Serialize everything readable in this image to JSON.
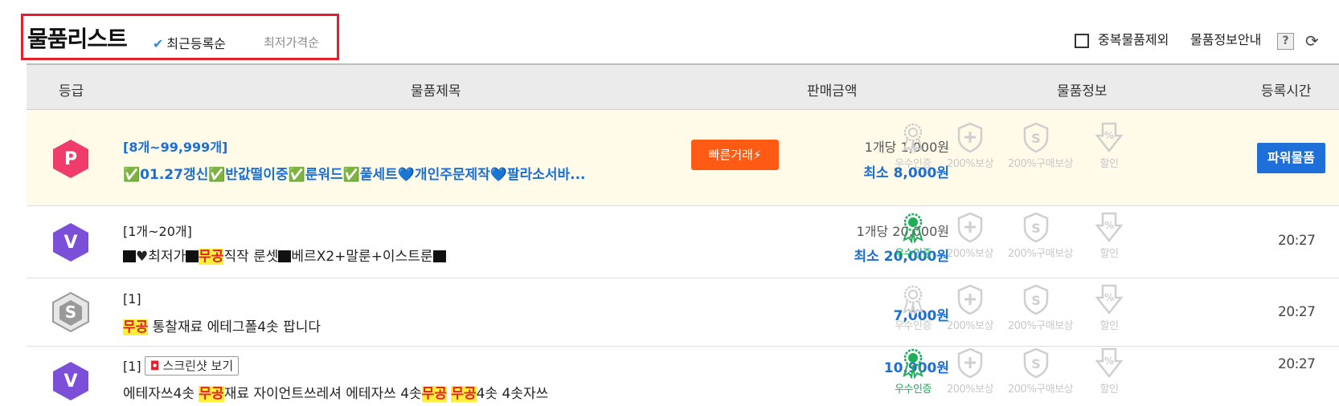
{
  "header": {
    "title": "물품리스트",
    "sort_recent": "최근등록순",
    "sort_low": "최저가격순",
    "exclude_dup": "중복물품제외",
    "item_info_guide": "물품정보안내",
    "help_icon": "?"
  },
  "columns": [
    "등급",
    "물품제목",
    "판매금액",
    "물품정보",
    "등록시간"
  ],
  "badge_labels": [
    "우수인증",
    "200%보상",
    "200%구매보상",
    "할인"
  ],
  "rows": [
    {
      "grade": "P",
      "grade_color": "#f03c6a",
      "qty": "[8개~99,999개]",
      "title": "✅01.27갱신✅반값떨이중✅룬워드✅풀세트💙개인주문제작💙팔라소서바...",
      "fast_trade": "빠른거래⚡",
      "unit_price": "1개당 1,000원",
      "min_price": "최소 8,000원",
      "badges_on": [
        false,
        false,
        false,
        false
      ],
      "power_label": "파워물품"
    },
    {
      "grade": "V",
      "grade_color": "#7b4fd8",
      "qty": "[1개~20개]",
      "title_parts": [
        "♥최저가",
        "무공",
        "직작 룬셋",
        "베르X2+말룬+이스트룬"
      ],
      "unit_price": "1개당 20,000원",
      "min_price": "최소 20,000원",
      "badges_on": [
        true,
        false,
        false,
        false
      ],
      "time": "20:27"
    },
    {
      "grade": "S",
      "grade_color": "#9a9a9a",
      "qty": "[1]",
      "title_parts": [
        "무공",
        " 통찰재료 에테그폴4솟 팝니다"
      ],
      "min_price": "7,000원",
      "badges_on": [
        false,
        false,
        false,
        false
      ],
      "time": "20:27"
    },
    {
      "grade": "V",
      "grade_color": "#7b4fd8",
      "qty": "[1]",
      "screenshot_btn": "스크린샷 보기",
      "title_parts": [
        "에테자쓰4솟 ",
        "무공",
        "재료 자이언트쓰레셔 에테자쓰 4솟",
        "무공",
        " ",
        "무공",
        "4솟 4솟자쓰"
      ],
      "min_price": "10,900원",
      "badges_on": [
        true,
        false,
        false,
        false
      ],
      "time": "20:27"
    }
  ]
}
